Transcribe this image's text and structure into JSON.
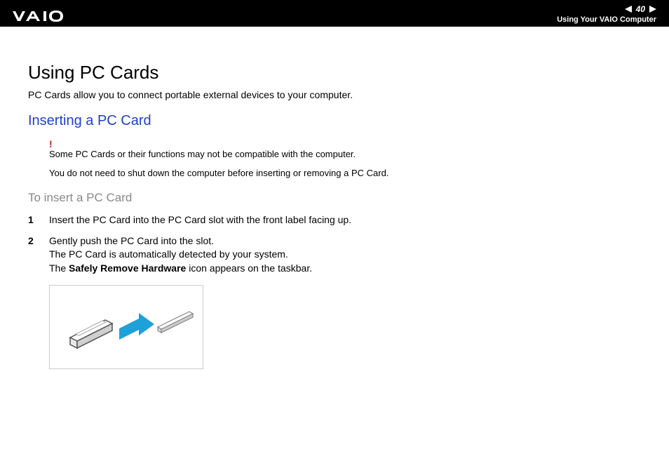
{
  "header": {
    "page_number": "40",
    "breadcrumb": "Using Your VAIO Computer"
  },
  "content": {
    "title": "Using PC Cards",
    "intro": "PC Cards allow you to connect portable external devices to your computer.",
    "subheading": "Inserting a PC Card",
    "warn_mark": "!",
    "note1": "Some PC Cards or their functions may not be compatible with the computer.",
    "note2": "You do not need to shut down the computer before inserting or removing a PC Card.",
    "procedure_title": "To insert a PC Card",
    "steps": {
      "s1": {
        "num": "1",
        "text": "Insert the PC Card into the PC Card slot with the front label facing up."
      },
      "s2": {
        "num": "2",
        "line1": "Gently push the PC Card into the slot.",
        "line2": "The PC Card is automatically detected by your system.",
        "line3a": "The ",
        "line3b": "Safely Remove Hardware",
        "line3c": " icon appears on the taskbar."
      }
    }
  }
}
